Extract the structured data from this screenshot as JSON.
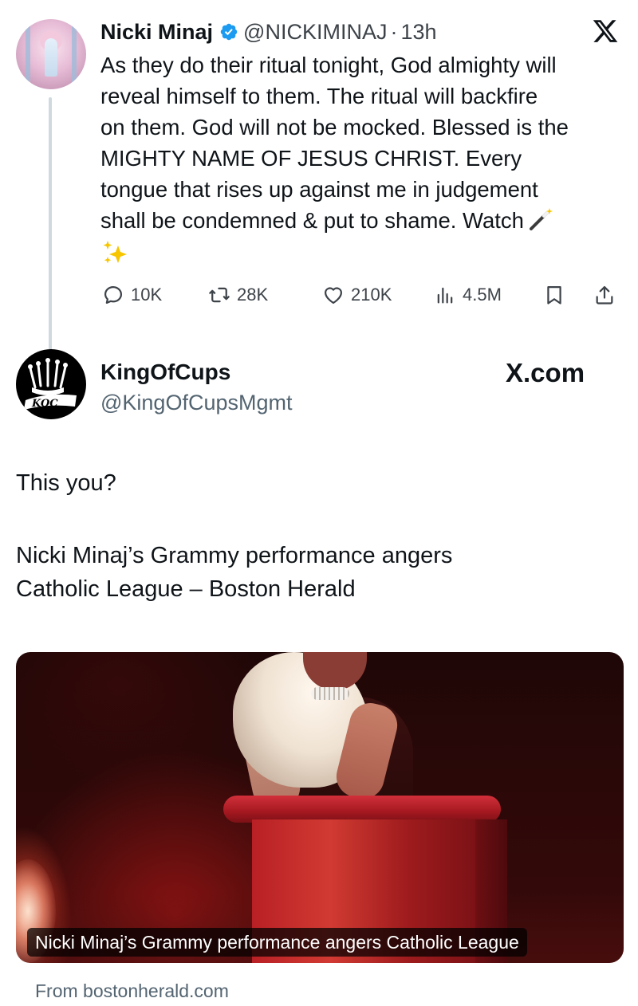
{
  "quoted_tweet": {
    "author_name": "Nicki Minaj",
    "handle": "@NICKIMINAJ",
    "separator": "·",
    "time": "13h",
    "verified_icon": "verified-badge-icon",
    "verified_color": "#1d9bf0",
    "platform_icon": "x-logo-icon",
    "text": "As they do their ritual tonight, God almighty will\nreveal himself to them. The ritual will backfire\non them. God will not be mocked. Blessed is the\nMIGHTY NAME OF JESUS CHRIST. Every\ntongue that rises up against me in judgement\nshall be condemned & put to shame. Watch",
    "emojis": [
      "magic-wand-emoji",
      "sparkles-emoji"
    ],
    "actions": {
      "replies": "10K",
      "reposts": "28K",
      "likes": "210K",
      "views": "4.5M"
    }
  },
  "main_tweet": {
    "author_name": "KingOfCups",
    "handle": "@KingOfCupsMgmt",
    "watermark": "X.com",
    "line1": "This you?",
    "line2": "Nicki Minaj’s Grammy performance angers\nCatholic League – Boston Herald",
    "card": {
      "caption": "Nicki Minaj’s Grammy performance angers Catholic League",
      "source": "From bostonherald.com"
    }
  }
}
